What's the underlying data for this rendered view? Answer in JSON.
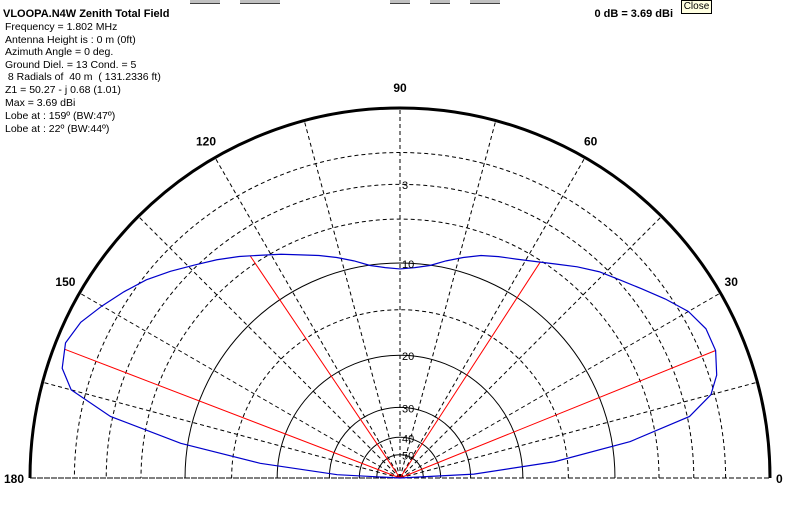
{
  "window": {
    "title": "VLOOPA.N4W Zenith Total Field",
    "reference": "0 dB = 3.69 dBi",
    "close_label": "Close"
  },
  "info_lines": [
    "Frequency  = 1.802 MHz",
    "Antenna Height is : 0 m (0ft)",
    "Azimuth Angle = 0 deg.",
    "Ground Diel. = 13  Cond. = 5",
    " 8 Radials of  40 m  ( 131.2336 ft)",
    "Z1 = 50.27 -  j 0.68 (1.01)",
    "Max = 3.69 dBi",
    "Lobe at : 159º (BW:47º)",
    "Lobe at : 22º (BW:44º)"
  ],
  "chart_data": {
    "type": "polar",
    "coverage": "half",
    "angle_labels": [
      {
        "angle": 0,
        "label": "0"
      },
      {
        "angle": 30,
        "label": "30"
      },
      {
        "angle": 60,
        "label": "60"
      },
      {
        "angle": 90,
        "label": "90"
      },
      {
        "angle": 120,
        "label": "120"
      },
      {
        "angle": 150,
        "label": "150"
      },
      {
        "angle": 180,
        "label": "180"
      }
    ],
    "ring_labels": [
      {
        "fraction": 0.794,
        "label": "3"
      },
      {
        "fraction": 0.581,
        "label": "10"
      },
      {
        "fraction": 0.332,
        "label": "20"
      },
      {
        "fraction": 0.191,
        "label": "30"
      },
      {
        "fraction": 0.11,
        "label": "40"
      },
      {
        "fraction": 0.063,
        "label": "50"
      }
    ],
    "outer_ring_fraction": 1.0,
    "dashed_spokes_every_deg": 15,
    "pattern": {
      "name": "Total Field",
      "color": "#0000cc",
      "angles_deg": [
        0,
        3,
        6,
        9,
        12,
        15,
        18,
        22,
        26,
        30,
        34,
        38,
        42,
        46,
        50,
        54,
        58,
        62,
        66,
        70,
        74,
        78,
        82,
        86,
        90,
        94,
        98,
        102,
        106,
        110,
        114,
        118,
        122,
        126,
        130,
        134,
        138,
        142,
        146,
        150,
        154,
        158,
        162,
        165,
        168,
        171,
        174,
        177,
        180
      ],
      "radius_fraction": [
        0.0,
        0.2,
        0.42,
        0.63,
        0.8,
        0.87,
        0.9,
        0.92,
        0.92,
        0.9,
        0.865,
        0.83,
        0.8,
        0.775,
        0.745,
        0.715,
        0.69,
        0.67,
        0.655,
        0.64,
        0.62,
        0.6,
        0.58,
        0.57,
        0.565,
        0.57,
        0.58,
        0.6,
        0.62,
        0.64,
        0.66,
        0.685,
        0.71,
        0.74,
        0.77,
        0.8,
        0.835,
        0.87,
        0.9,
        0.93,
        0.96,
        0.975,
        0.96,
        0.92,
        0.8,
        0.6,
        0.38,
        0.17,
        0.0
      ]
    },
    "lobe_markers": [
      {
        "angle": 159,
        "color": "#ff0000"
      },
      {
        "angle": 22,
        "color": "#ff0000"
      },
      {
        "angle": 57,
        "color": "#ff0000"
      },
      {
        "angle": 124,
        "color": "#ff0000"
      }
    ]
  }
}
